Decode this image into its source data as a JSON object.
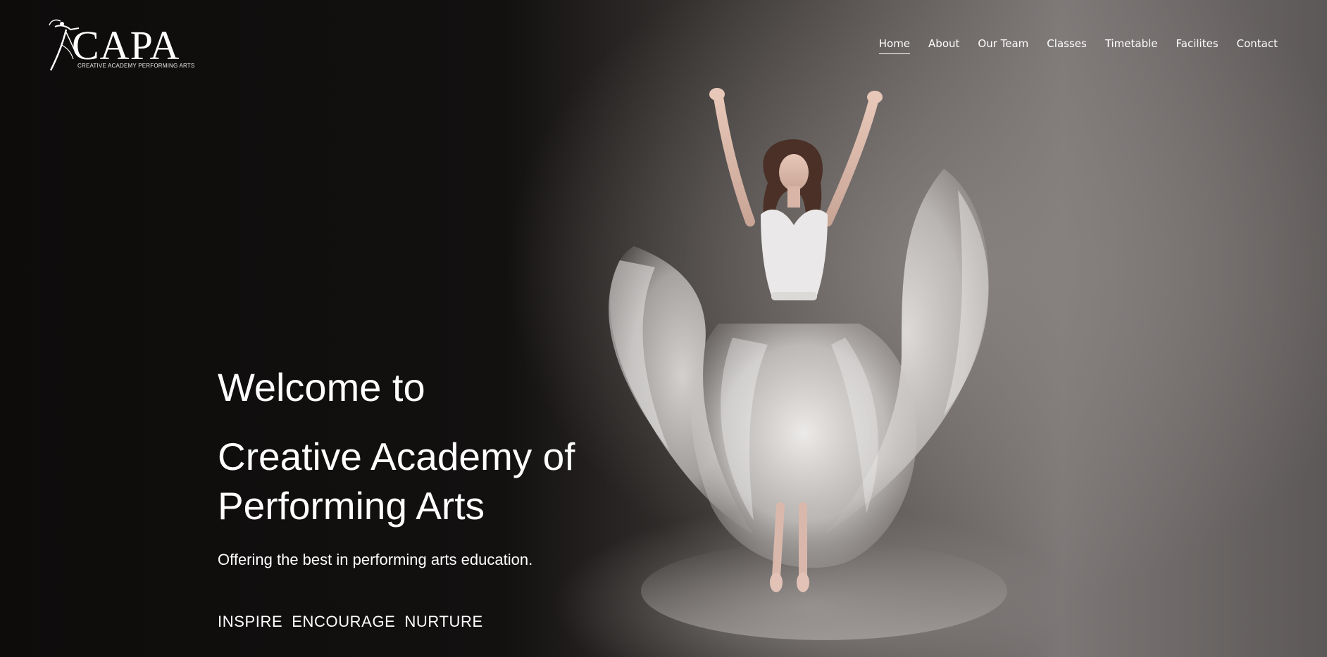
{
  "logo": {
    "wordmark": "CAPA",
    "subtitle": "CREATIVE ACADEMY PERFORMING ARTS"
  },
  "nav": {
    "items": [
      {
        "label": "Home",
        "active": true
      },
      {
        "label": "About",
        "active": false
      },
      {
        "label": "Our Team",
        "active": false
      },
      {
        "label": "Classes",
        "active": false
      },
      {
        "label": "Timetable",
        "active": false
      },
      {
        "label": "Facilites",
        "active": false
      },
      {
        "label": "Contact",
        "active": false
      }
    ]
  },
  "hero": {
    "welcome": "Welcome to",
    "academy": "Creative Academy of Performing Arts",
    "tagline": "Offering the best in performing arts education.",
    "motto": [
      "INSPIRE",
      "ENCOURAGE",
      "NURTURE"
    ]
  },
  "colors": {
    "text": "#ffffff",
    "background_dark": "#0d0c0b",
    "background_light": "#7c7776"
  }
}
